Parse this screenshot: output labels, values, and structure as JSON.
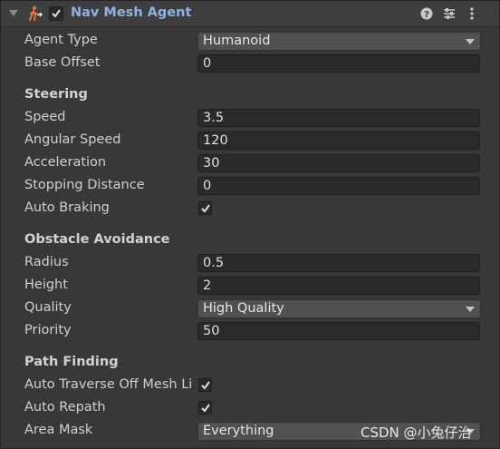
{
  "header": {
    "title": "Nav Mesh Agent",
    "enabled": true,
    "icons": [
      "navmesh-agent-icon",
      "help-icon",
      "preset-icon",
      "more-icon"
    ]
  },
  "fields": {
    "agent_type": {
      "label": "Agent Type",
      "value": "Humanoid"
    },
    "base_offset": {
      "label": "Base Offset",
      "value": "0"
    }
  },
  "steering": {
    "title": "Steering",
    "speed": {
      "label": "Speed",
      "value": "3.5"
    },
    "angular_speed": {
      "label": "Angular Speed",
      "value": "120"
    },
    "acceleration": {
      "label": "Acceleration",
      "value": "30"
    },
    "stopping_distance": {
      "label": "Stopping Distance",
      "value": "0"
    },
    "auto_braking": {
      "label": "Auto Braking",
      "checked": true
    }
  },
  "obstacle": {
    "title": "Obstacle Avoidance",
    "radius": {
      "label": "Radius",
      "value": "0.5"
    },
    "height": {
      "label": "Height",
      "value": "2"
    },
    "quality": {
      "label": "Quality",
      "value": "High Quality"
    },
    "priority": {
      "label": "Priority",
      "value": "50"
    }
  },
  "path": {
    "title": "Path Finding",
    "auto_traverse": {
      "label": "Auto Traverse Off Mesh Li",
      "checked": true
    },
    "auto_repath": {
      "label": "Auto Repath",
      "checked": true
    },
    "area_mask": {
      "label": "Area Mask",
      "value": "Everything"
    }
  },
  "watermark": "CSDN @小兔仔治",
  "colors": {
    "accent": "#8eb2e6",
    "background": "#383838",
    "field": "#2a2a2a"
  }
}
